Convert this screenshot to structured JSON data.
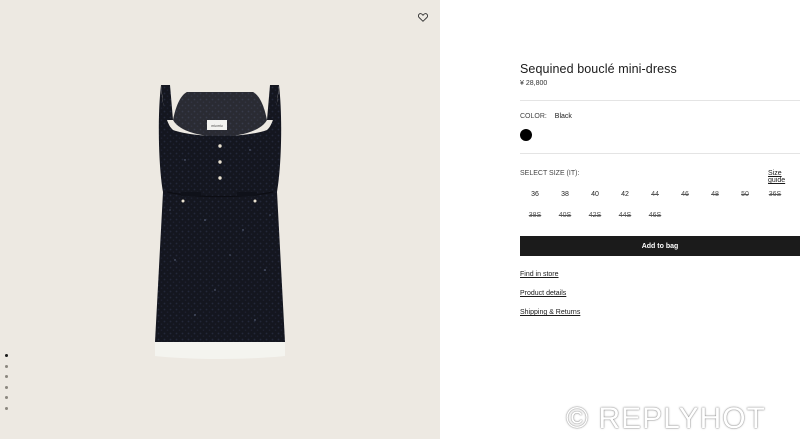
{
  "product": {
    "title": "Sequined bouclé mini-dress",
    "price": "¥ 28,800",
    "image_alt": "black-dress-image"
  },
  "color": {
    "label": "COLOR:",
    "value": "Black",
    "swatch_hex": "#000000"
  },
  "sizes": {
    "label": "SELECT SIZE (IT):",
    "guide_label": "Size guide",
    "row1": [
      {
        "label": "36",
        "available": true
      },
      {
        "label": "38",
        "available": true
      },
      {
        "label": "40",
        "available": true
      },
      {
        "label": "42",
        "available": true
      },
      {
        "label": "44",
        "available": false
      },
      {
        "label": "46",
        "available": false
      },
      {
        "label": "48",
        "available": false
      },
      {
        "label": "50",
        "available": false
      },
      {
        "label": "36S",
        "available": false
      }
    ],
    "row2": [
      {
        "label": "38S",
        "available": false
      },
      {
        "label": "40S",
        "available": false
      },
      {
        "label": "42S",
        "available": false
      },
      {
        "label": "44S",
        "available": false
      },
      {
        "label": "46S",
        "available": false
      }
    ]
  },
  "actions": {
    "add_to_bag": "Add to bag",
    "find_in_store": "Find in store",
    "product_details": "Product details",
    "shipping_returns": "Shipping & Returns"
  },
  "gallery": {
    "total_images": 6,
    "active_index": 0,
    "background_hex": "#ede9e2"
  },
  "icons": {
    "wishlist": "heart-icon"
  },
  "watermark": "© REPLYHOT"
}
